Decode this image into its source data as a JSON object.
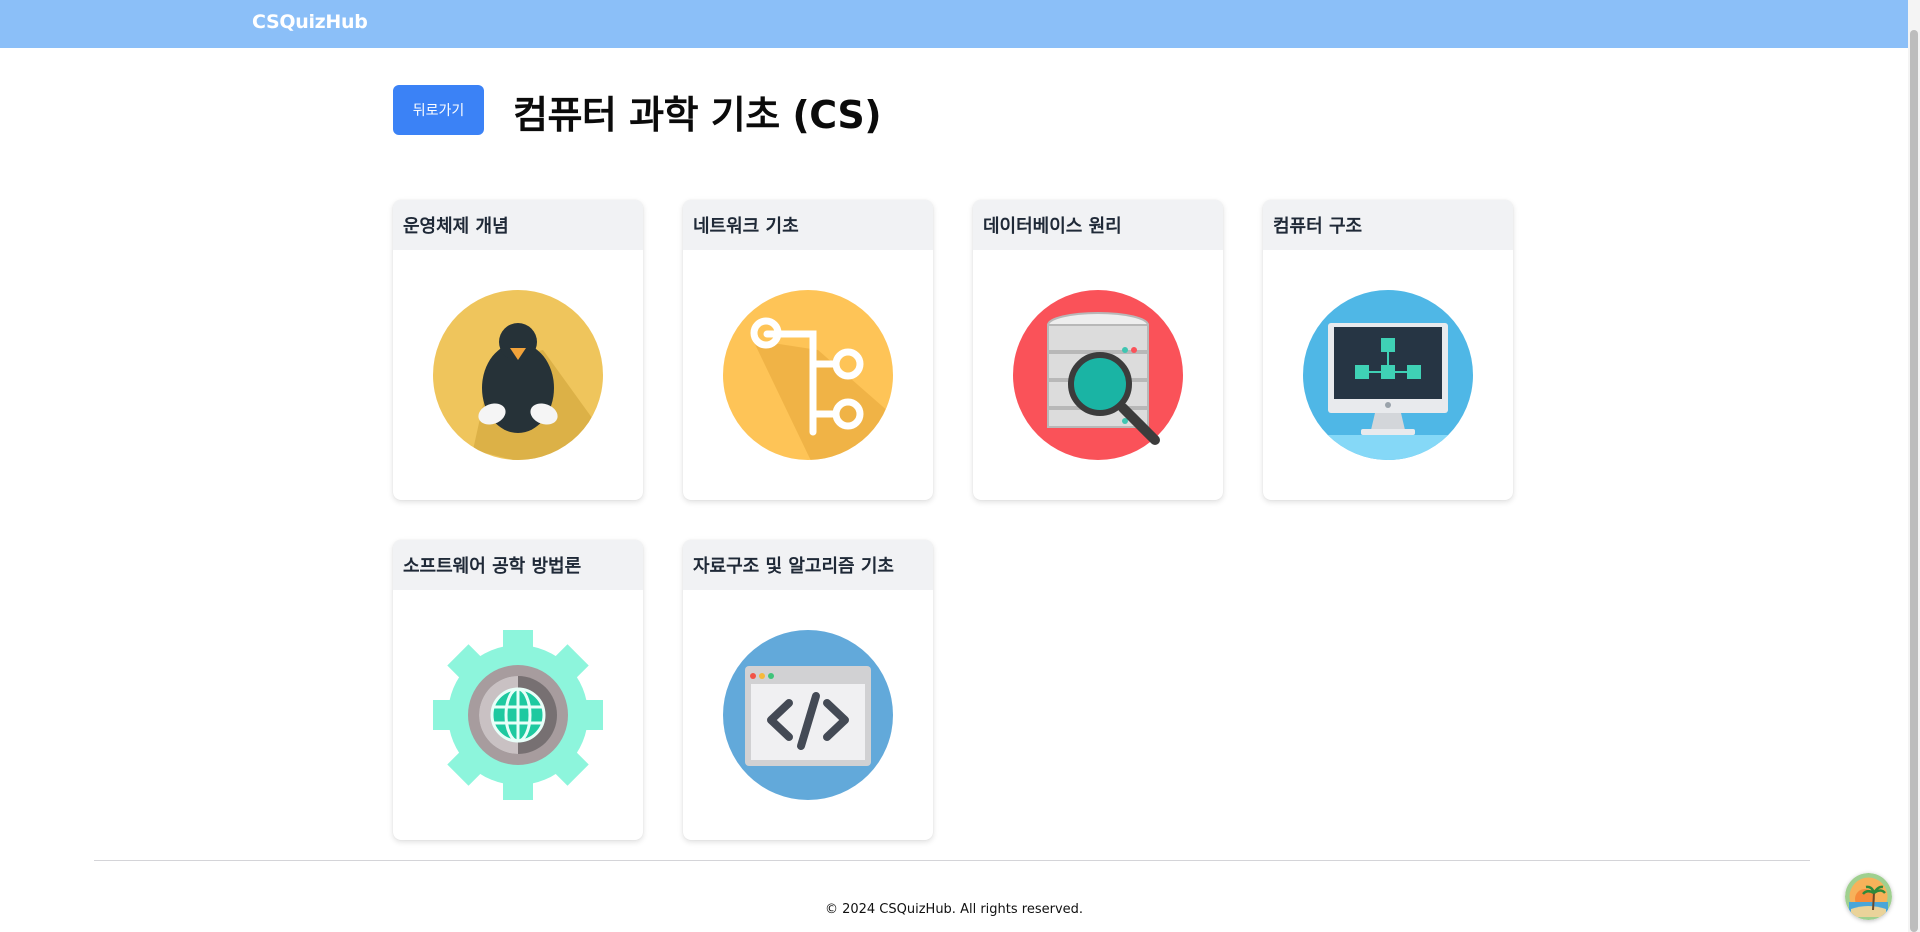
{
  "header": {
    "brand": "CSQuizHub"
  },
  "main": {
    "back_label": "뒤로가기",
    "title": "컴퓨터 과학 기초 (CS)",
    "cards": [
      {
        "title": "운영체제 개념",
        "icon": "linux-penguin-icon"
      },
      {
        "title": "네트워크 기초",
        "icon": "git-branch-icon"
      },
      {
        "title": "데이터베이스 원리",
        "icon": "database-search-icon"
      },
      {
        "title": "컴퓨터 구조",
        "icon": "computer-monitor-icon"
      },
      {
        "title": "소프트웨어 공학 방법론",
        "icon": "gear-globe-icon"
      },
      {
        "title": "자료구조 및 알고리즘 기초",
        "icon": "code-window-icon"
      }
    ]
  },
  "footer": {
    "copyright": "© 2024 CSQuizHub. All rights reserved."
  },
  "colors": {
    "header_bg": "#8bbff8",
    "accent": "#3b82f6",
    "card_header_bg": "#f1f2f4"
  }
}
